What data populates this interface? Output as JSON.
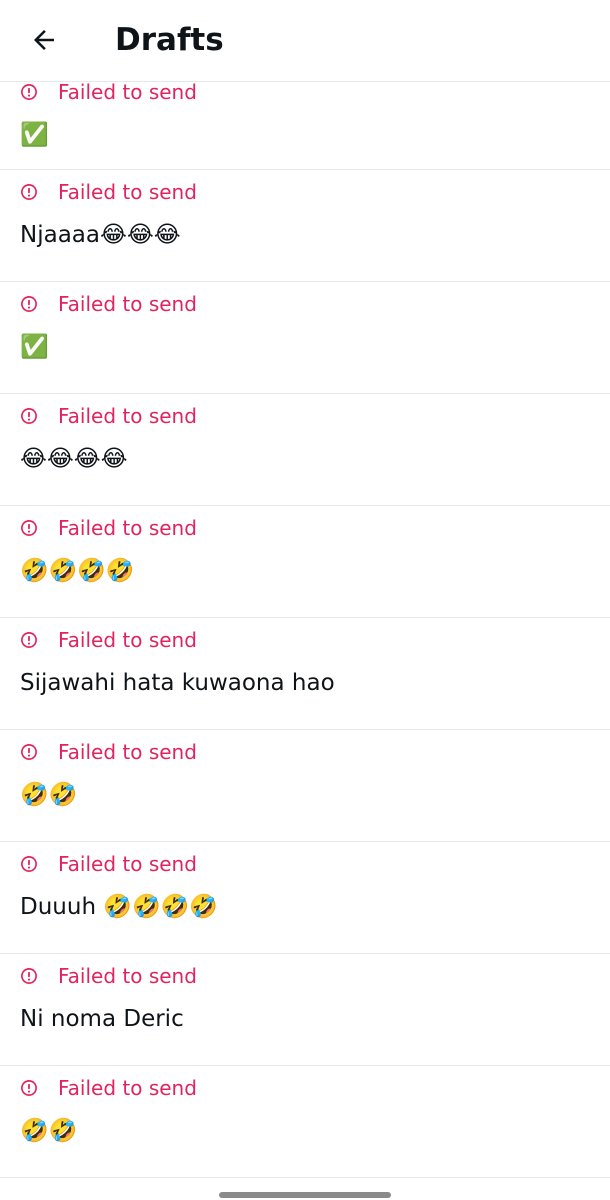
{
  "header": {
    "title": "Drafts",
    "back_icon": "arrow-left-icon"
  },
  "status_icon": "alert-circle-icon",
  "colors": {
    "error": "#e0245e",
    "text": "#0f1419",
    "divider": "#e6e8ea"
  },
  "drafts": [
    {
      "status": "Failed to send",
      "text": "✅"
    },
    {
      "status": "Failed to send",
      "text": "Njaaaa😂😂😂"
    },
    {
      "status": "Failed to send",
      "text": "✅"
    },
    {
      "status": "Failed to send",
      "text": "😂😂😂😂"
    },
    {
      "status": "Failed to send",
      "text": "🤣🤣🤣🤣"
    },
    {
      "status": "Failed to send",
      "text": "Sijawahi hata kuwaona hao"
    },
    {
      "status": "Failed to send",
      "text": "🤣🤣"
    },
    {
      "status": "Failed to send",
      "text": "Duuuh 🤣🤣🤣🤣"
    },
    {
      "status": "Failed to send",
      "text": "Ni noma Deric"
    },
    {
      "status": "Failed to send",
      "text": "🤣🤣"
    }
  ]
}
